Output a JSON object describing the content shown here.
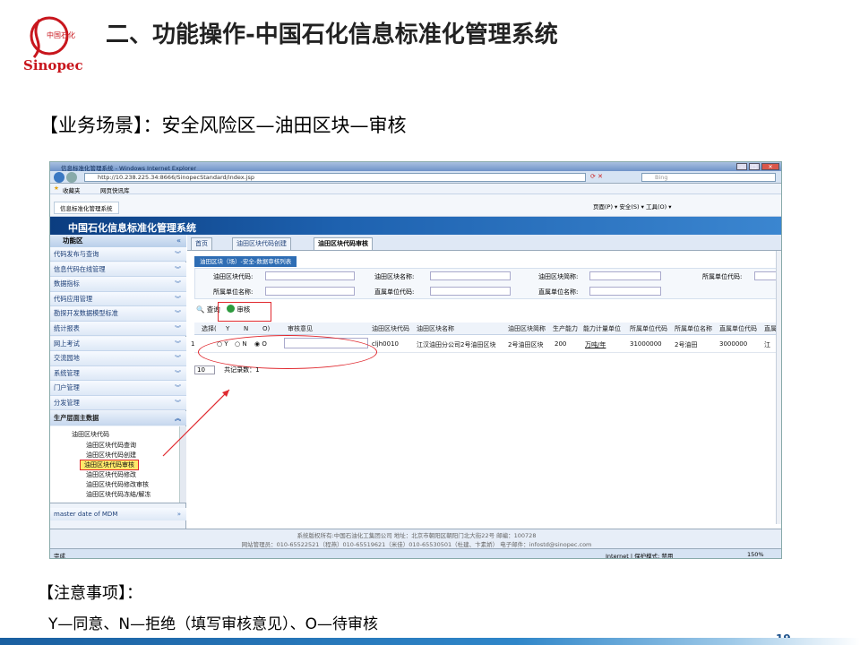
{
  "slide": {
    "logo_text": "中国石化",
    "logo_word": "Sinopec",
    "title": "二、功能操作-中国石化信息标准化管理系统",
    "scenario": "【业务场景】：安全风险区—油田区块—审核",
    "notes_title": "【注意事项】：",
    "notes_text": "Y—同意、N—拒绝（填写审核意见）、O—待审核",
    "page_number": "19"
  },
  "browser": {
    "window_title": "信息标准化管理系统 - Windows Internet Explorer",
    "address": "http://10.238.225.34:8666/SinopecStandard/index.jsp",
    "search_placeholder": "Bing",
    "favorites_label": "收藏夹",
    "suggested_sites": "网页快讯库",
    "tab_label": "信息标准化管理系统",
    "toolbar_right": "页面(P) ▾  安全(S) ▾  工具(O) ▾",
    "status_left": "完成",
    "status_zone": "Internet | 保护模式: 禁用",
    "zoom": "150%"
  },
  "app": {
    "banner_title": "中国石化信息标准化管理系统",
    "sidebar_header": "功能区",
    "sidebar_items": [
      "代码发布与查询",
      "信息代码在线管理",
      "数据指标",
      "代码应用管理",
      "勘探开发数据模型标准",
      "统计报表",
      "网上考试",
      "交流园地",
      "系统管理",
      "门户管理",
      "分发管理",
      "生产层面主数据"
    ],
    "tree": {
      "parent": "油田区块代码",
      "children": [
        "油田区块代码查询",
        "油田区块代码创建",
        "油田区块代码审核",
        "油田区块代码修改",
        "油田区块代码修改审核",
        "油田区块代码冻结/解冻"
      ],
      "selected": "油田区块代码审核"
    },
    "sidebar_footer": "master date of MDM",
    "content_tabs": [
      "首页",
      "油田区块代码创建",
      "油田区块代码审核"
    ],
    "subtab": "油田区块（场）-安全-数据审核列表",
    "form_labels": {
      "block_code": "油田区块代码:",
      "block_name": "油田区块名称:",
      "block_abbr": "油田区块简称:",
      "unit_code": "所属单位代码:",
      "unit_name": "所属单位名称:",
      "direct_unit_code": "直属单位代码:",
      "direct_unit_name": "直属单位名称:"
    },
    "query_button": "查询",
    "audit_button": "审核",
    "grid": {
      "headers": [
        "选择(",
        "Y",
        "N",
        "O)",
        "审核意见",
        "油田区块代码",
        "油田区块名称",
        "油田区块简称",
        "生产能力",
        "能力计量单位",
        "所属单位代码",
        "所属单位名称",
        "直属单位代码",
        "直属"
      ],
      "row": {
        "index": "1",
        "radio_y": "Y",
        "radio_n": "N",
        "radio_o": "O",
        "code": "cljh0010",
        "name": "江汉油田分公司2号油田区块",
        "abbr": "2号油田区块",
        "capacity": "200",
        "unit": "万吨/年",
        "unit_code": "31000000",
        "unit_name": "2号油田",
        "direct_code": "3000000",
        "direct_name": "江"
      }
    },
    "pager_size": "10",
    "pager_text": "共记录数：1",
    "footer_line1": "系统版权所有:中国石油化工集团公司    地址：北京市朝阳区朝阳门北大街22号    邮编：100728",
    "footer_line2": "网站管理员：010-65522521（程燕）010-65519621（米佳）010-65530501（杜建、卞素娇）  电子邮件：infostd@sinopec.com"
  },
  "colors": {
    "banner": "#1e62b0",
    "highlight": "#e0292f",
    "selected_tree": "#ffe96b"
  }
}
